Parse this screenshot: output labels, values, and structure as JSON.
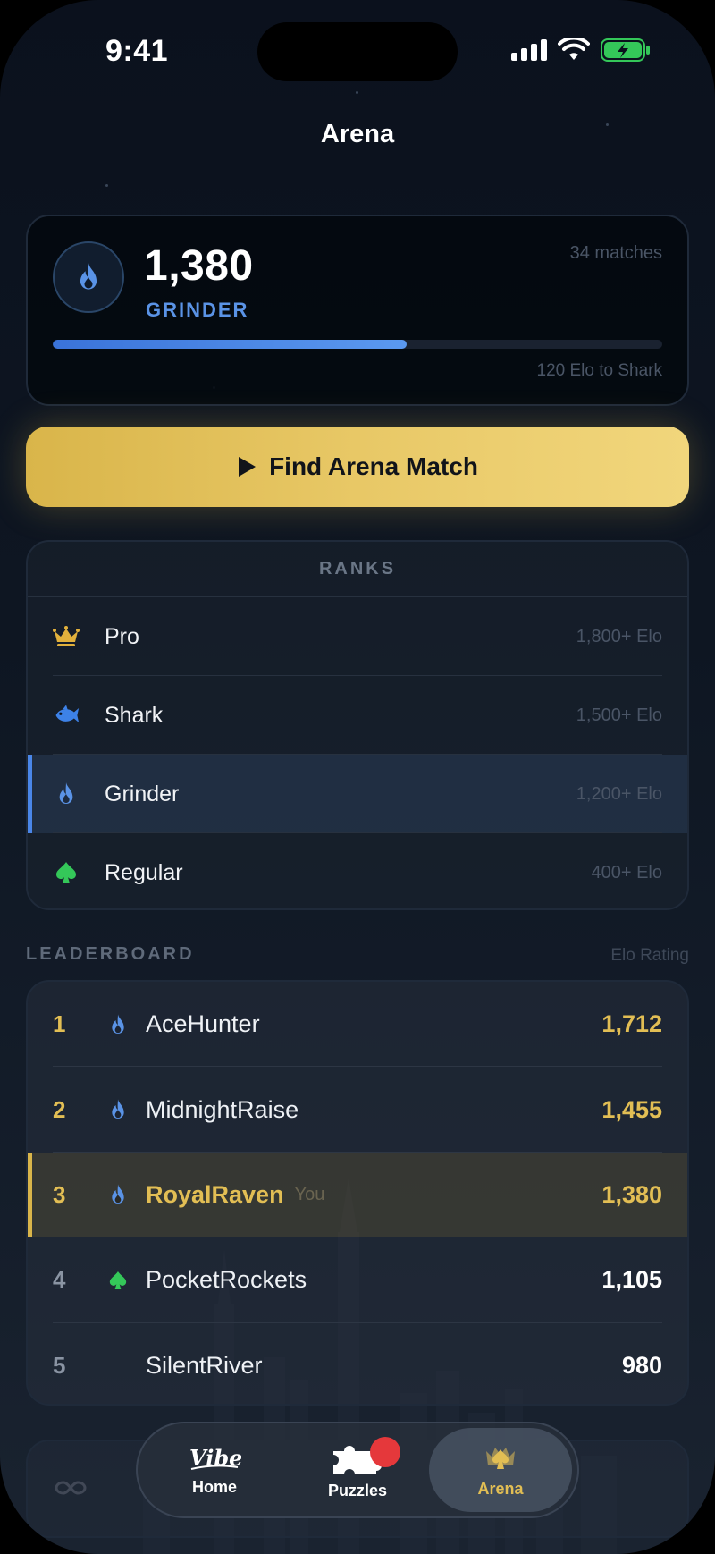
{
  "status_bar": {
    "time": "9:41"
  },
  "header": {
    "title": "Arena"
  },
  "rating_card": {
    "elo": "1,380",
    "rank": "GRINDER",
    "matches": "34 matches",
    "progress_fraction": 0.58,
    "next_rank_text": "120 Elo to Shark",
    "rank_icon": "flame-icon"
  },
  "find_match": {
    "label": "Find Arena Match",
    "icon": "play-icon"
  },
  "ranks": {
    "header": "RANKS",
    "items": [
      {
        "name": "Pro",
        "threshold": "1,800+ Elo",
        "icon": "crown-icon",
        "color": "#e2b13c",
        "current": false
      },
      {
        "name": "Shark",
        "threshold": "1,500+ Elo",
        "icon": "fish-icon",
        "color": "#3d82e8",
        "current": false
      },
      {
        "name": "Grinder",
        "threshold": "1,200+ Elo",
        "icon": "flame-icon",
        "color": "#5a93e6",
        "current": true
      },
      {
        "name": "Regular",
        "threshold": "400+ Elo",
        "icon": "spade-icon",
        "color": "#34c759",
        "current": false
      }
    ]
  },
  "leaderboard": {
    "heading": "LEADERBOARD",
    "subheading": "Elo Rating",
    "you_label": "You",
    "rows": [
      {
        "position": "1",
        "name": "AceHunter",
        "score": "1,712",
        "icon": "flame-icon",
        "is_you": false
      },
      {
        "position": "2",
        "name": "MidnightRaise",
        "score": "1,455",
        "icon": "flame-icon",
        "is_you": false
      },
      {
        "position": "3",
        "name": "RoyalRaven",
        "score": "1,380",
        "icon": "flame-icon",
        "is_you": true
      },
      {
        "position": "4",
        "name": "PocketRockets",
        "score": "1,105",
        "icon": "spade-icon",
        "is_you": false
      },
      {
        "position": "5",
        "name": "SilentRiver",
        "score": "980",
        "icon": "",
        "is_you": false
      }
    ]
  },
  "tab_bar": {
    "tabs": [
      {
        "label": "Home",
        "icon": "vibe-logo-icon",
        "active": false
      },
      {
        "label": "Puzzles",
        "icon": "puzzle-icon",
        "active": false,
        "badge": true
      },
      {
        "label": "Arena",
        "icon": "spade-crown-icon",
        "active": true
      }
    ]
  },
  "colors": {
    "accent_gold": "#e2be54",
    "accent_blue": "#4a86e8",
    "background": "#0e1622"
  }
}
